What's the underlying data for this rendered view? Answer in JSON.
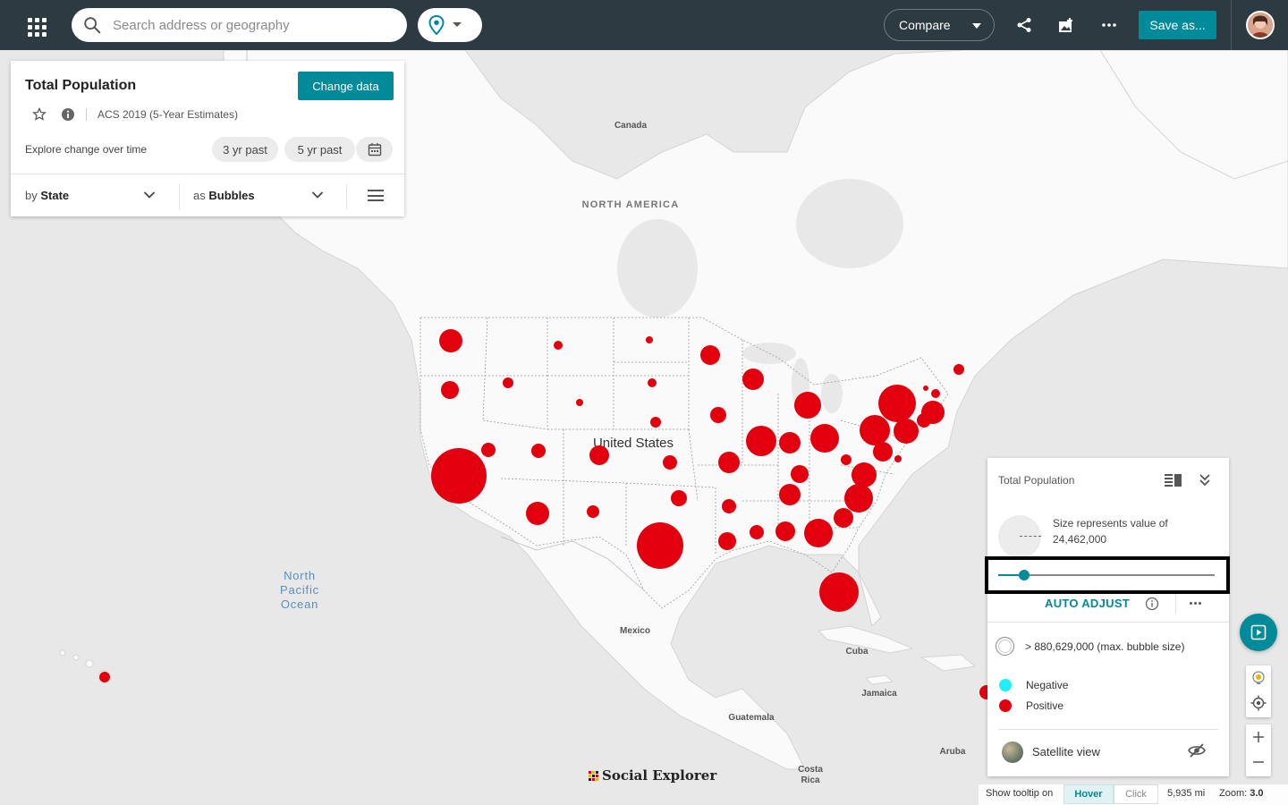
{
  "topbar": {
    "search_placeholder": "Search address or geography",
    "compare_label": "Compare",
    "save_label": "Save as..."
  },
  "data_panel": {
    "title": "Total Population",
    "change_data_label": "Change data",
    "source": "ACS 2019 (5-Year Estimates)",
    "explore_label": "Explore change over time",
    "past_3": "3 yr past",
    "past_5": "5 yr past",
    "by_prefix": "by",
    "by_value": "State",
    "as_prefix": "as",
    "as_value": "Bubbles"
  },
  "map": {
    "labels": {
      "canada": "Canada",
      "north_america": "NORTH AMERICA",
      "united_states": "United States",
      "ocean_1": "North",
      "ocean_2": "Pacific",
      "ocean_3": "Ocean",
      "mexico": "Mexico",
      "cuba": "Cuba",
      "jamaica": "Jamaica",
      "guatemala": "Guatemala",
      "aruba": "Aruba",
      "costa_rica_1": "Costa",
      "costa_rica_2": "Rica"
    },
    "bubble_color": "#e2000f"
  },
  "legend": {
    "title": "Total Population",
    "size_label": "Size represents value of",
    "size_value": "24,462,000",
    "slider_fraction": 0.12,
    "auto_adjust_label": "AUTO ADJUST",
    "max_label": "> 880,629,000 (max. bubble size)",
    "negative_label": "Negative",
    "negative_color": "#1ef0f5",
    "positive_label": "Positive",
    "positive_color": "#e2000f",
    "satellite_label": "Satellite view"
  },
  "bottom": {
    "logo_text": "Social Explorer",
    "tooltip_label": "Show tooltip on",
    "hover_label": "Hover",
    "click_label": "Click",
    "scale_label": "5,935 mi",
    "zoom_label": "Zoom:",
    "zoom_value": "3.0"
  },
  "colors": {
    "topbar": "#2c3a42",
    "accent": "#008a9a"
  }
}
